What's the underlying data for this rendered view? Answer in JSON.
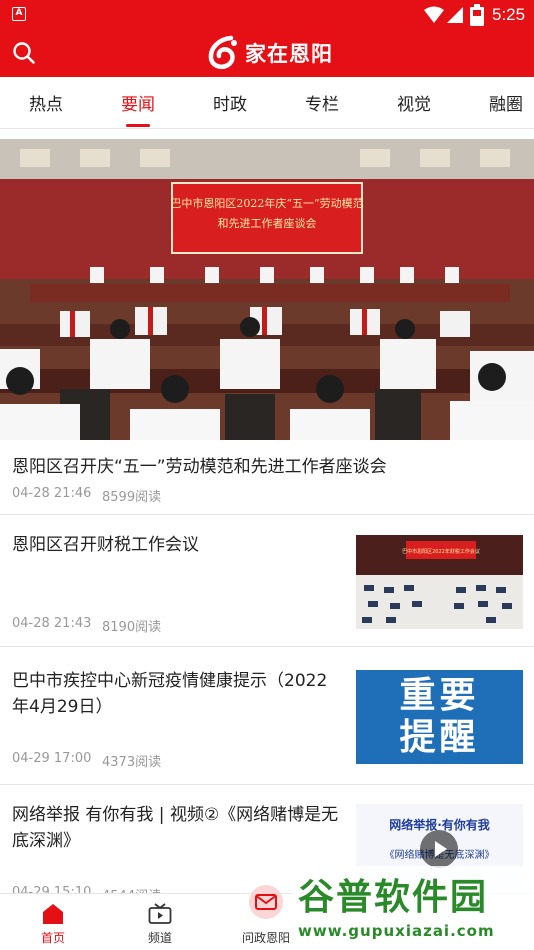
{
  "status_bar": {
    "app_badge": "A",
    "time": "5:25"
  },
  "app": {
    "logo_text": "家在恩阳"
  },
  "tabs": [
    {
      "label": "热点"
    },
    {
      "label": "要闻",
      "active": true
    },
    {
      "label": "时政"
    },
    {
      "label": "专栏"
    },
    {
      "label": "视觉"
    },
    {
      "label": "融圈"
    }
  ],
  "hero": {
    "banner_line1": "巴中市恩阳区2022年庆“五一”劳动模范",
    "banner_line2": "和先进工作者座谈会",
    "title": "恩阳区召开庆“五一”劳动模范和先进工作者座谈会",
    "date": "04-28 21:46",
    "reads": "8599阅读"
  },
  "news": [
    {
      "title": "恩阳区召开财税工作会议",
      "date": "04-28 21:43",
      "reads": "8190阅读",
      "thumb_text": "巴中市恩阳区2022年财税工作会议"
    },
    {
      "title": "巴中市疾控中心新冠疫情健康提示（2022年4月29日）",
      "date": "04-29 17:00",
      "reads": "4373阅读",
      "thumb_line1": "重要",
      "thumb_line2": "提醒"
    },
    {
      "title": "网络举报 有你有我 | 视频②《网络赌博是无底深渊》",
      "date": "04-29 15:10",
      "reads": "4544阅读",
      "thumb_line1": "网络举报·有你有我",
      "thumb_line2": "《网络赌博是无底深渊》"
    }
  ],
  "bottom_nav": [
    {
      "label": "首页",
      "active": true
    },
    {
      "label": "频道"
    },
    {
      "label": "问政恩阳"
    }
  ],
  "watermark": {
    "main": "谷普软件园",
    "url": "www.gupuxiazai.com"
  },
  "colors": {
    "brand_red": "#e50f16",
    "meta_gray": "#999999",
    "reminder_blue": "#1f6fb8"
  }
}
